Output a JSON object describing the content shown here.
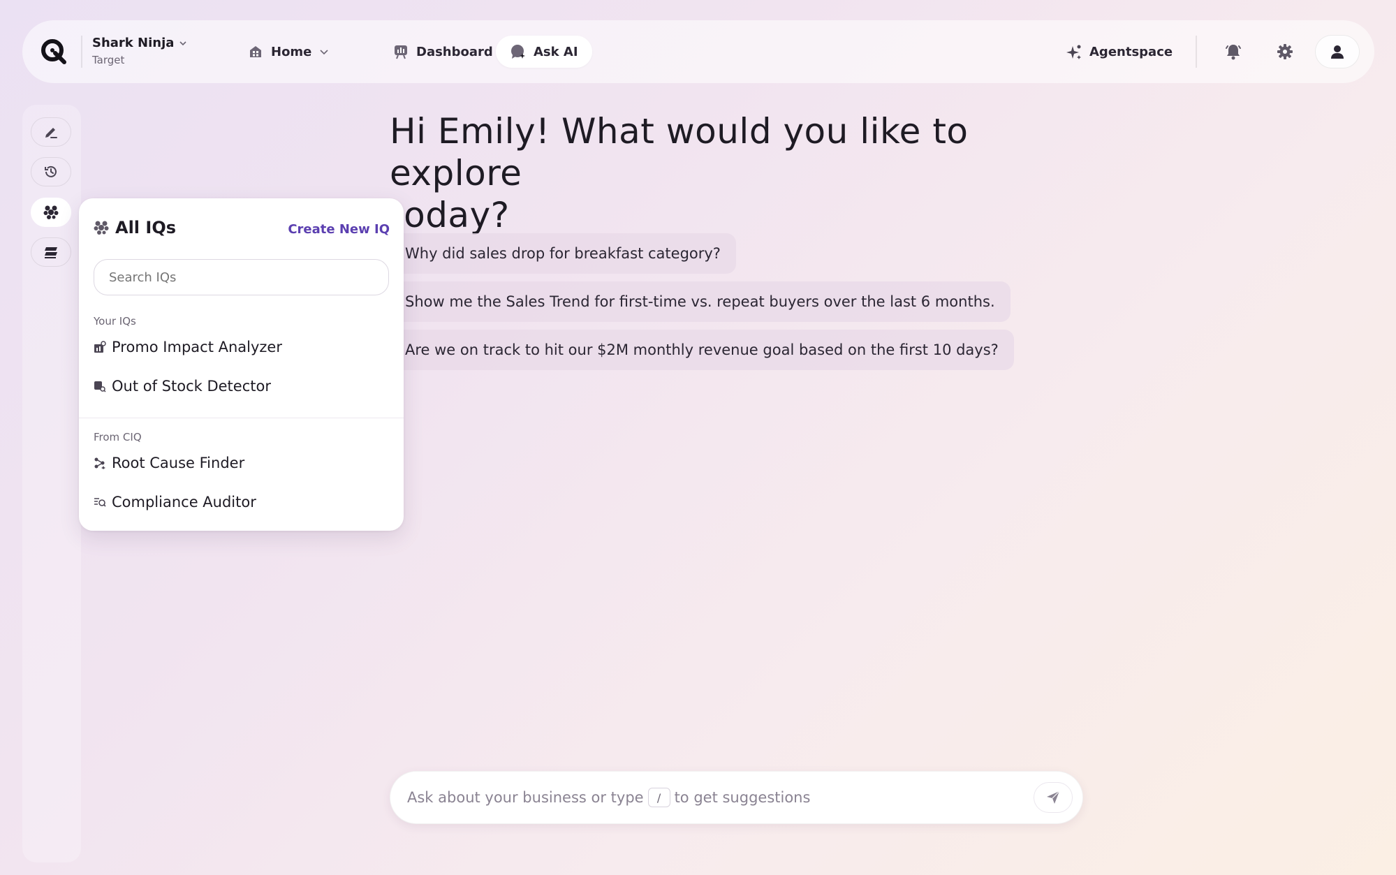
{
  "header": {
    "org_name": "Shark Ninja",
    "org_sub": "Target",
    "nav": [
      {
        "label": "Home",
        "icon": "home-icon"
      },
      {
        "label": "Dashboard",
        "icon": "dashboard-icon"
      },
      {
        "label": "Ask AI",
        "icon": "ask-ai-icon"
      }
    ],
    "agentspace_label": "Agentspace"
  },
  "main": {
    "headline_line1": "Hi Emily! What would you like to explore",
    "headline_line2": "today?",
    "suggestions": [
      "Why did sales drop for breakfast category?",
      "Show me the Sales Trend for first-time vs. repeat buyers over the last 6 months.",
      "Are we on track to hit our $2M monthly revenue goal based on the first 10 days?"
    ]
  },
  "iq_panel": {
    "title": "All IQs",
    "create_label": "Create New IQ",
    "search_placeholder": "Search IQs",
    "your_section": "Your IQs",
    "your_items": [
      "Promo Impact Analyzer",
      "Out of Stock Detector"
    ],
    "from_section": "From CIQ",
    "from_items": [
      "Root Cause Finder",
      "Compliance Auditor"
    ]
  },
  "ask": {
    "prefix": "Ask about your business or type",
    "key": "/",
    "suffix": "to get suggestions"
  },
  "colors": {
    "accent": "#5b3fb0",
    "chip_bg": "#e8d9e8"
  }
}
